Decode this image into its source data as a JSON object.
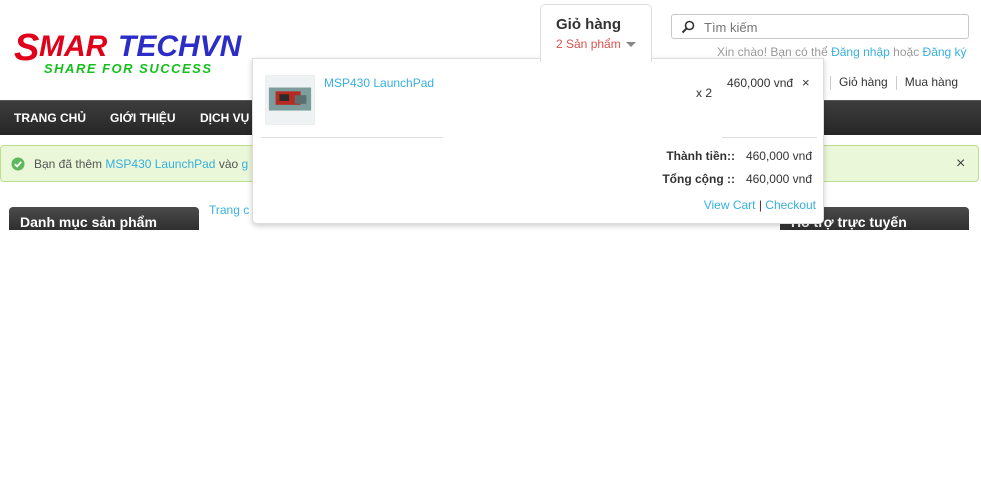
{
  "logo": {
    "text_main": "SMARTECHVN",
    "tagline": "SHARE FOR SUCCESS",
    "colors": {
      "red": "#e1001a",
      "blue": "#2c2cc6",
      "green": "#15c01d"
    }
  },
  "search": {
    "placeholder": "Tìm kiếm",
    "icon": "search-icon"
  },
  "welcome": {
    "text_prefix": "Xin chào! Bạn có thể",
    "login_link": "Đăng nhập",
    "or_text": "hoặc",
    "register_link": "Đăng ký"
  },
  "user_links": {
    "cart": "Giỏ hàng",
    "checkout": "Mua hàng"
  },
  "nav": {
    "items": [
      "TRANG CHỦ",
      "GIỚI THIỆU",
      "DỊCH VỤ"
    ]
  },
  "alert": {
    "icon": "check-circle-icon",
    "text_prefix": "Bạn đã thêm",
    "product_link": "MSP430 LaunchPad",
    "text_mid": "vào",
    "cart_link": "g",
    "close": "×",
    "colors": {
      "bg": "#eaf7d9",
      "border": "#bbdf8d"
    }
  },
  "sidebar_left": {
    "title": "Danh mục sản phẩm"
  },
  "sidebar_right": {
    "title": "Hỗ trợ trực tuyến"
  },
  "breadcrumb": {
    "text": "Trang c"
  },
  "cart": {
    "title": "Giỏ hàng",
    "count_label": "2 Sản phẩm",
    "items": [
      {
        "name": "MSP430 LaunchPad",
        "qty": "x 2",
        "price": "460,000 vnđ",
        "remove": "×"
      }
    ],
    "subtotal_label": "Thành tiền::",
    "subtotal_value": "460,000 vnđ",
    "total_label": "Tổng cộng ::",
    "total_value": "460,000 vnđ",
    "view_cart": "View Cart",
    "separator": "|",
    "checkout": "Checkout"
  },
  "colors": {
    "link": "#38b0de",
    "cart_count": "#d9534f",
    "nav_bg": "#2e2e2e"
  }
}
